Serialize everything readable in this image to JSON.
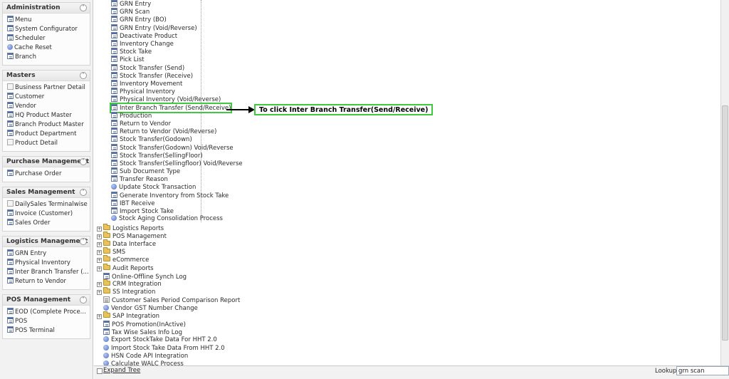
{
  "sidebar": {
    "panels": [
      {
        "title": "Administration",
        "items": [
          {
            "label": "Menu",
            "icon": "window"
          },
          {
            "label": "System Configurator",
            "icon": "window"
          },
          {
            "label": "Scheduler",
            "icon": "window"
          },
          {
            "label": "Cache Reset",
            "icon": "process"
          },
          {
            "label": "Branch",
            "icon": "window"
          }
        ]
      },
      {
        "title": "Masters",
        "items": [
          {
            "label": "Business Partner Detail",
            "icon": "form"
          },
          {
            "label": "Customer",
            "icon": "window"
          },
          {
            "label": "Vendor",
            "icon": "window"
          },
          {
            "label": "HQ Product Master",
            "icon": "window"
          },
          {
            "label": "Branch Product Master",
            "icon": "window"
          },
          {
            "label": "Product Department",
            "icon": "window"
          },
          {
            "label": "Product Detail",
            "icon": "form"
          }
        ]
      },
      {
        "title": "Purchase Management",
        "items": [
          {
            "label": "Purchase Order",
            "icon": "window"
          }
        ]
      },
      {
        "title": "Sales Management",
        "items": [
          {
            "label": "DailySales Terminalwise",
            "icon": "form"
          },
          {
            "label": "Invoice (Customer)",
            "icon": "window"
          },
          {
            "label": "Sales Order",
            "icon": "window"
          }
        ]
      },
      {
        "title": "Logistics Management",
        "items": [
          {
            "label": "GRN Entry",
            "icon": "window"
          },
          {
            "label": "Physical Inventory",
            "icon": "window"
          },
          {
            "label": "Inter Branch Transfer (...",
            "icon": "window"
          },
          {
            "label": "Return to Vendor",
            "icon": "window"
          }
        ]
      },
      {
        "title": "POS Management",
        "items": [
          {
            "label": "EOD (Complete Proce...",
            "icon": "window"
          },
          {
            "label": "POS",
            "icon": "window"
          },
          {
            "label": "POS Terminal",
            "icon": "window"
          }
        ]
      }
    ]
  },
  "tree": {
    "children": [
      {
        "label": "GRN Entry",
        "icon": "window"
      },
      {
        "label": "GRN Scan",
        "icon": "window"
      },
      {
        "label": "GRN Entry (BO)",
        "icon": "window"
      },
      {
        "label": "GRN Entry (Void/Reverse)",
        "icon": "window"
      },
      {
        "label": "Deactivate Product",
        "icon": "window"
      },
      {
        "label": "Inventory Change",
        "icon": "window"
      },
      {
        "label": "Stock Take",
        "icon": "window"
      },
      {
        "label": "Pick List",
        "icon": "window"
      },
      {
        "label": "Stock Transfer (Send)",
        "icon": "window"
      },
      {
        "label": "Stock Transfer (Receive)",
        "icon": "window"
      },
      {
        "label": "Inventory Movement",
        "icon": "window"
      },
      {
        "label": "Physical Inventory",
        "icon": "window"
      },
      {
        "label": "Physical Inventory (Void/Reverse)",
        "icon": "window"
      },
      {
        "label": "Inter Branch Transfer (Send/Receive)",
        "icon": "window",
        "highlighted": true
      },
      {
        "label": "Production",
        "icon": "window"
      },
      {
        "label": "Return to Vendor",
        "icon": "window"
      },
      {
        "label": "Return to Vendor (Void/Reverse)",
        "icon": "window"
      },
      {
        "label": "Stock Transfer(Godown)",
        "icon": "window"
      },
      {
        "label": "Stock Transfer(Godown) Void/Reverse",
        "icon": "window"
      },
      {
        "label": "Stock Transfer(SellingFloor)",
        "icon": "window"
      },
      {
        "label": "Stock Transfer(Sellingfloor) Void/Reverse",
        "icon": "window"
      },
      {
        "label": "Sub Document Type",
        "icon": "window"
      },
      {
        "label": "Transfer Reason",
        "icon": "window"
      },
      {
        "label": "Update Stock Transaction",
        "icon": "process"
      },
      {
        "label": "Generate Inventory from Stock Take",
        "icon": "window"
      },
      {
        "label": "IBT Receive",
        "icon": "window"
      },
      {
        "label": "Import Stock Take",
        "icon": "window"
      },
      {
        "label": "Stock Aging Consolidation Process",
        "icon": "process"
      }
    ],
    "top_level": [
      {
        "label": "Logistics Reports",
        "icon": "folder",
        "expander": "+"
      },
      {
        "label": "POS Management",
        "icon": "folder",
        "expander": "+"
      },
      {
        "label": "Data Interface",
        "icon": "folder",
        "expander": "+"
      },
      {
        "label": "SMS",
        "icon": "folder",
        "expander": "+"
      },
      {
        "label": "eCommerce",
        "icon": "folder",
        "expander": "+"
      },
      {
        "label": "Audit Reports",
        "icon": "folder",
        "expander": "+"
      },
      {
        "label": "Online-Offline Synch Log",
        "icon": "window",
        "expander": ""
      },
      {
        "label": "CRM Integration",
        "icon": "folder",
        "expander": "+"
      },
      {
        "label": "SS Integration",
        "icon": "folder",
        "expander": "+"
      },
      {
        "label": "Customer Sales Period Comparison Report",
        "icon": "report",
        "expander": ""
      },
      {
        "label": "Vendor GST Number Change",
        "icon": "process",
        "expander": ""
      },
      {
        "label": "SAP Integration",
        "icon": "folder",
        "expander": "+"
      },
      {
        "label": "POS Promotion(InActive)",
        "icon": "window",
        "expander": ""
      },
      {
        "label": "Tax Wise Sales Info Log",
        "icon": "window",
        "expander": ""
      },
      {
        "label": "Export StockTake Data For HHT 2.0",
        "icon": "process",
        "expander": ""
      },
      {
        "label": "Import Stock Take Data From HHT 2.0",
        "icon": "process",
        "expander": ""
      },
      {
        "label": "HSN Code API Integration",
        "icon": "process",
        "expander": ""
      },
      {
        "label": "Calculate WALC Process",
        "icon": "process",
        "expander": ""
      }
    ]
  },
  "annotation": {
    "text": "To click Inter Branch Transfer(Send/Receive)",
    "color": "#3fc93f"
  },
  "bottom": {
    "expand_tree_label": "Expand Tree",
    "lookup_label": "Lookup",
    "lookup_value": "grn scan"
  }
}
